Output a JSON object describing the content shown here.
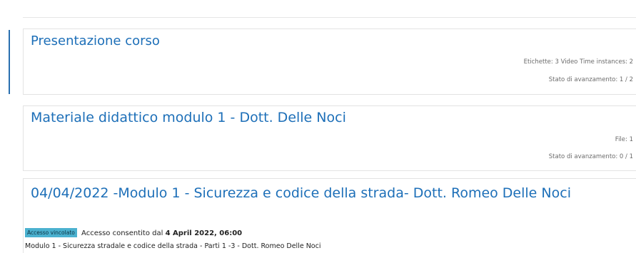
{
  "sections": [
    {
      "title": "Presentazione corso",
      "activities": "Etichette: 3  Video Time instances: 2",
      "progress": "Stato di avanzamento: 1 / 2"
    },
    {
      "title": "Materiale didattico modulo 1 - Dott. Delle Noci",
      "activities": "File: 1",
      "progress": "Stato di avanzamento: 0 / 1"
    },
    {
      "title": "04/04/2022 -Modulo 1 - Sicurezza e codice della strada- Dott. Romeo Delle Noci",
      "restriction_badge": "Accesso vincolato",
      "restriction_text": "Accesso consentito dal",
      "restriction_date": "4 April 2022, 06:00",
      "description": "Modulo 1 - Sicurezza stradale e codice della strada - Parti 1 -3 - Dott. Romeo Delle Noci"
    }
  ],
  "colors": {
    "title": "#1d6fb8",
    "badge": "#4bb1cf",
    "accent_bar": "#2a6fb0"
  }
}
